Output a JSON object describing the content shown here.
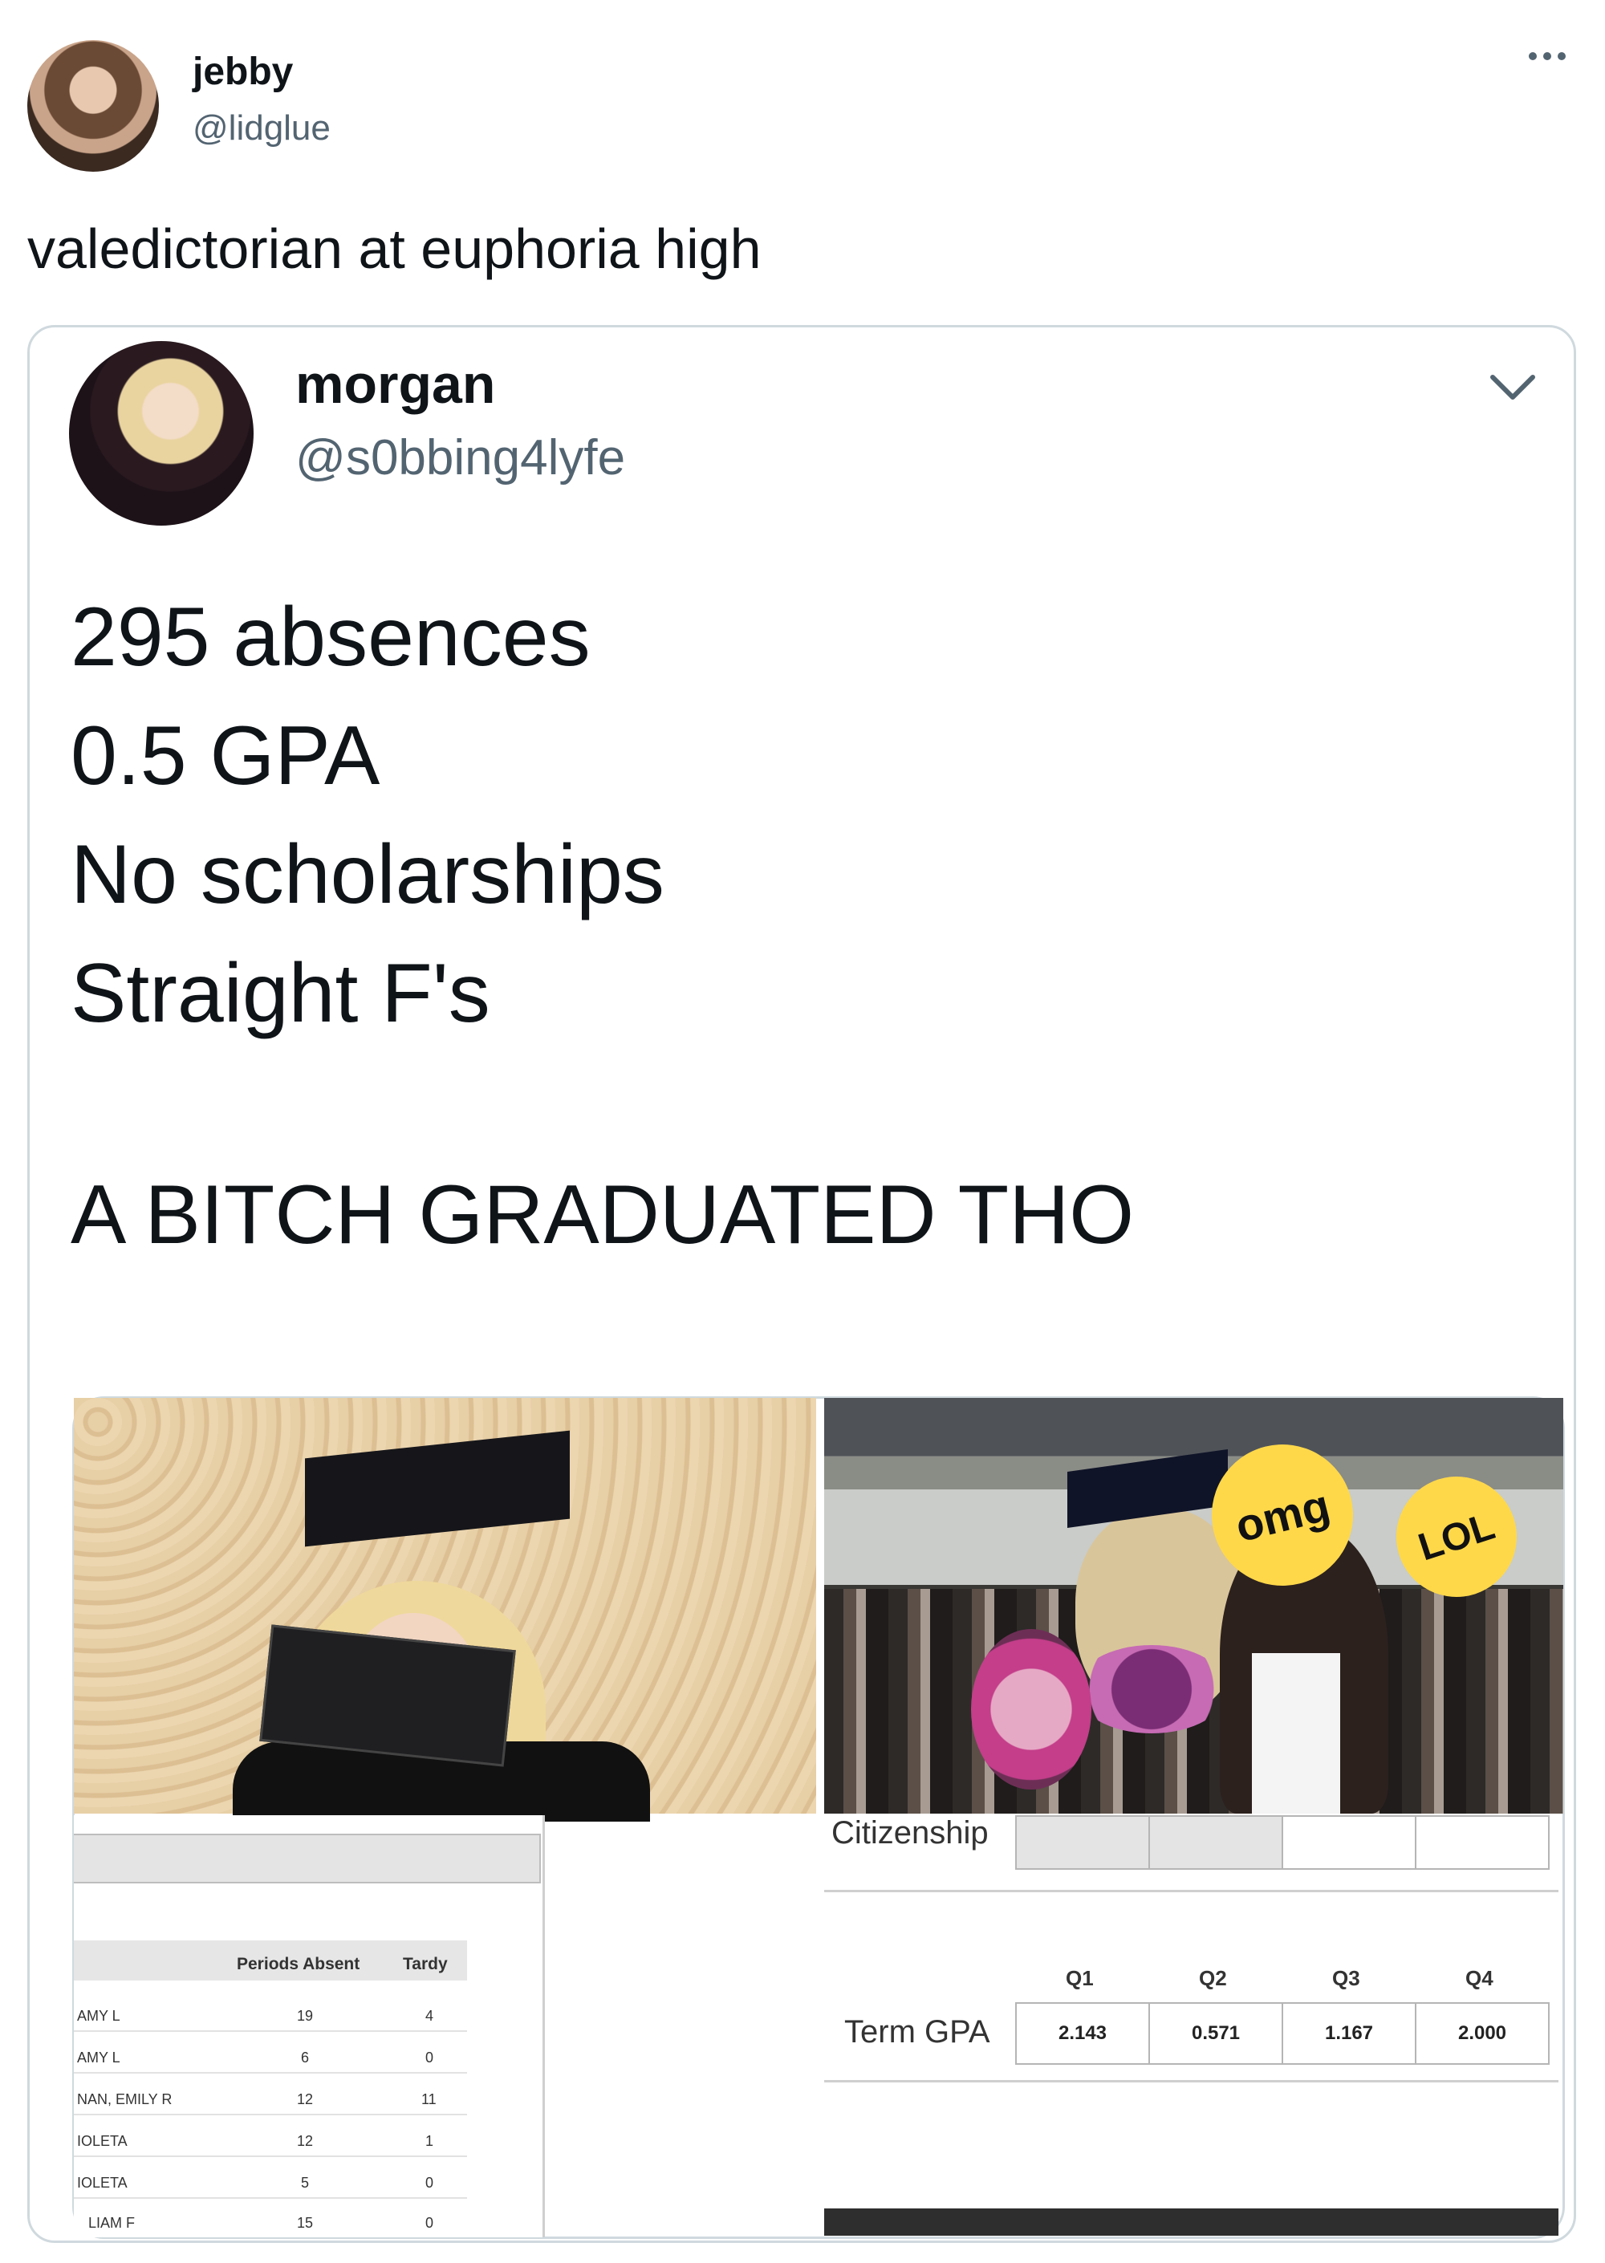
{
  "outer": {
    "name": "jebby",
    "handle": "@lidglue",
    "text": "valedictorian at euphoria high"
  },
  "quoted": {
    "name": "morgan",
    "handle": "@s0bbing4lyfe",
    "lines": [
      "295 absences",
      "0.5 GPA",
      "No scholarships",
      "Straight F's"
    ],
    "shout": "A BITCH GRADUATED THO"
  },
  "stickers": {
    "omg": "omg",
    "lol": "LOL"
  },
  "attendance": {
    "headers": [
      "Periods Absent",
      "Tardy"
    ],
    "rows": [
      {
        "name": "AMY L",
        "absent": "19",
        "tardy": "4"
      },
      {
        "name": "AMY L",
        "absent": "6",
        "tardy": "0"
      },
      {
        "name": "NAN, EMILY R",
        "absent": "12",
        "tardy": "11"
      },
      {
        "name": "IOLETA",
        "absent": "12",
        "tardy": "1"
      },
      {
        "name": "IOLETA",
        "absent": "5",
        "tardy": "0"
      },
      {
        "name": "LIAM F",
        "absent": "15",
        "tardy": "0"
      }
    ]
  },
  "grades": {
    "citizenship_label": "Citizenship",
    "gpa_label": "Term GPA",
    "quarters": [
      "Q1",
      "Q2",
      "Q3",
      "Q4"
    ],
    "term_gpa": [
      "2.143",
      "0.571",
      "1.167",
      "2.000"
    ]
  },
  "icons": {
    "more": "more-dots-icon",
    "chevron": "chevron-down-icon"
  }
}
